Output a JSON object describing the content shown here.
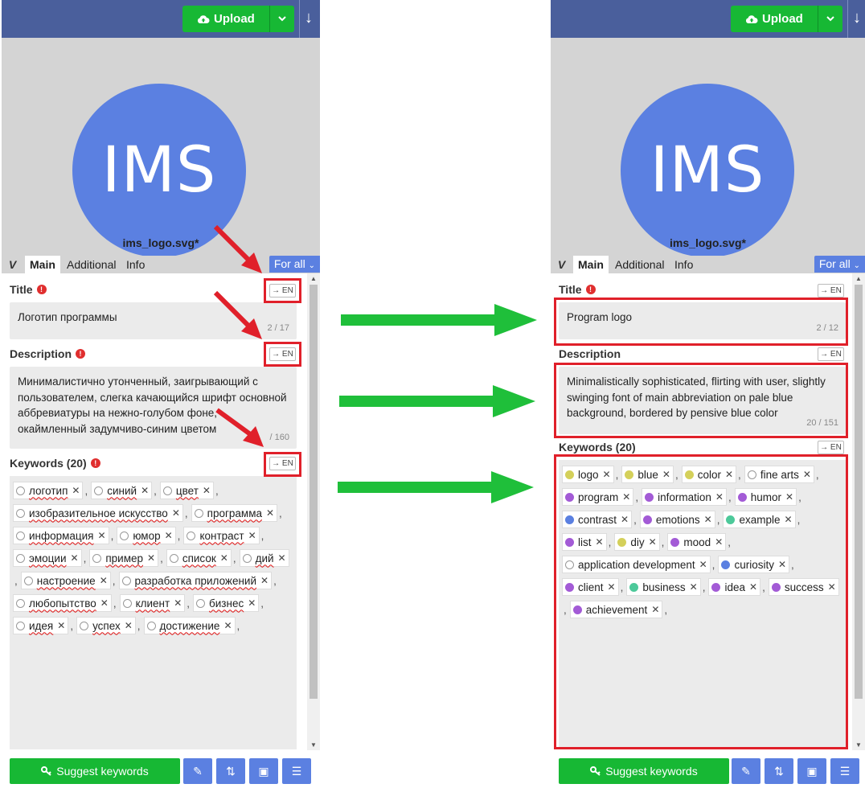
{
  "upload_label": "Upload",
  "download_icon": "↓",
  "logo_text": "IMS",
  "filename": "ims_logo.svg*",
  "tabs": {
    "main": "Main",
    "additional": "Additional",
    "info": "Info",
    "forall": "For all"
  },
  "en_label": "→ EN",
  "bottom": {
    "suggest": "Suggest keywords"
  },
  "left": {
    "title_label": "Title",
    "title_value": "Логотип программы",
    "title_counter": "2 / 17",
    "desc_label": "Description",
    "desc_value": "Минималистично утонченный, заигрывающий с пользователем, слегка качающийся шрифт основной аббревиатуры на нежно-голубом фоне, окаймленный задумчиво-синим цветом",
    "desc_counter": "/ 160",
    "kw_label": "Keywords (20)",
    "keywords": [
      "логотип",
      "синий",
      "цвет",
      "изобразительное искусство",
      "программа",
      "информация",
      "юмор",
      "контраст",
      "эмоции",
      "пример",
      "список",
      "дий",
      "настроение",
      "разработка приложений",
      "любопытство",
      "клиент",
      "бизнес",
      "идея",
      "успех",
      "достижение"
    ]
  },
  "right": {
    "title_label": "Title",
    "title_value": "Program logo",
    "title_counter": "2 / 12",
    "desc_label": "Description",
    "desc_value": "Minimalistically sophisticated, flirting with user, slightly swinging font of main abbreviation on pale blue background, bordered by pensive blue color",
    "desc_counter": "20 / 151",
    "kw_label": "Keywords (20)",
    "keywords": [
      {
        "t": "logo",
        "c": "#d4d05a"
      },
      {
        "t": "blue",
        "c": "#d4d05a"
      },
      {
        "t": "color",
        "c": "#d4d05a"
      },
      {
        "t": "fine arts",
        "c": "#ffffff"
      },
      {
        "t": "program",
        "c": "#a35bd6"
      },
      {
        "t": "information",
        "c": "#a35bd6"
      },
      {
        "t": "humor",
        "c": "#a35bd6"
      },
      {
        "t": "contrast",
        "c": "#5b80e1"
      },
      {
        "t": "emotions",
        "c": "#a35bd6"
      },
      {
        "t": "example",
        "c": "#4dc99a"
      },
      {
        "t": "list",
        "c": "#a35bd6"
      },
      {
        "t": "diy",
        "c": "#d4d05a"
      },
      {
        "t": "mood",
        "c": "#a35bd6"
      },
      {
        "t": "application development",
        "c": "#ffffff"
      },
      {
        "t": "curiosity",
        "c": "#5b80e1"
      },
      {
        "t": "client",
        "c": "#a35bd6"
      },
      {
        "t": "business",
        "c": "#4dc99a"
      },
      {
        "t": "idea",
        "c": "#a35bd6"
      },
      {
        "t": "success",
        "c": "#a35bd6"
      },
      {
        "t": "achievement",
        "c": "#a35bd6"
      }
    ]
  },
  "colors": {
    "accent_green": "#17b834",
    "accent_blue": "#5b80e1",
    "header": "#4a5f9c",
    "annotation_red": "#e0202a",
    "annotation_green": "#1fbf3a"
  }
}
